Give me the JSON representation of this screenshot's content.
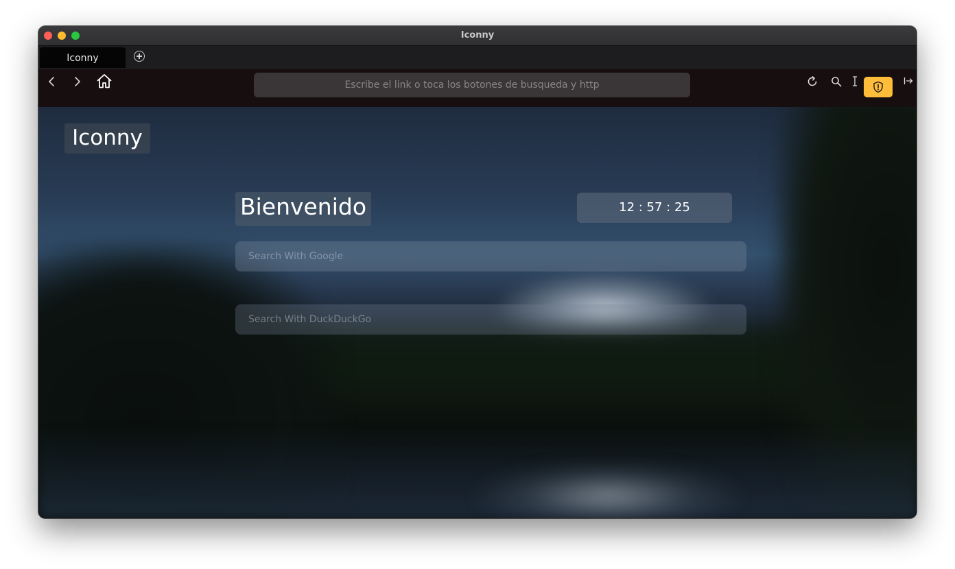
{
  "window": {
    "title": "Iconny"
  },
  "tabs": [
    {
      "label": "Iconny",
      "active": true
    }
  ],
  "toolbar": {
    "url_placeholder": "Escribe el link o toca los botones de busqueda y http",
    "accent_color": "#ffbd3a",
    "icons": [
      "back-icon",
      "forward-icon",
      "home-icon",
      "reload-icon",
      "search-icon",
      "text-cursor-icon",
      "shield-icon",
      "sidebar-toggle-icon"
    ]
  },
  "page": {
    "logo": "Iconny",
    "welcome": "Bienvenido",
    "clock": "12 : 57 : 25",
    "google_search_placeholder": "Search With Google",
    "duckduckgo_search_placeholder": "Search With DuckDuckGo"
  }
}
